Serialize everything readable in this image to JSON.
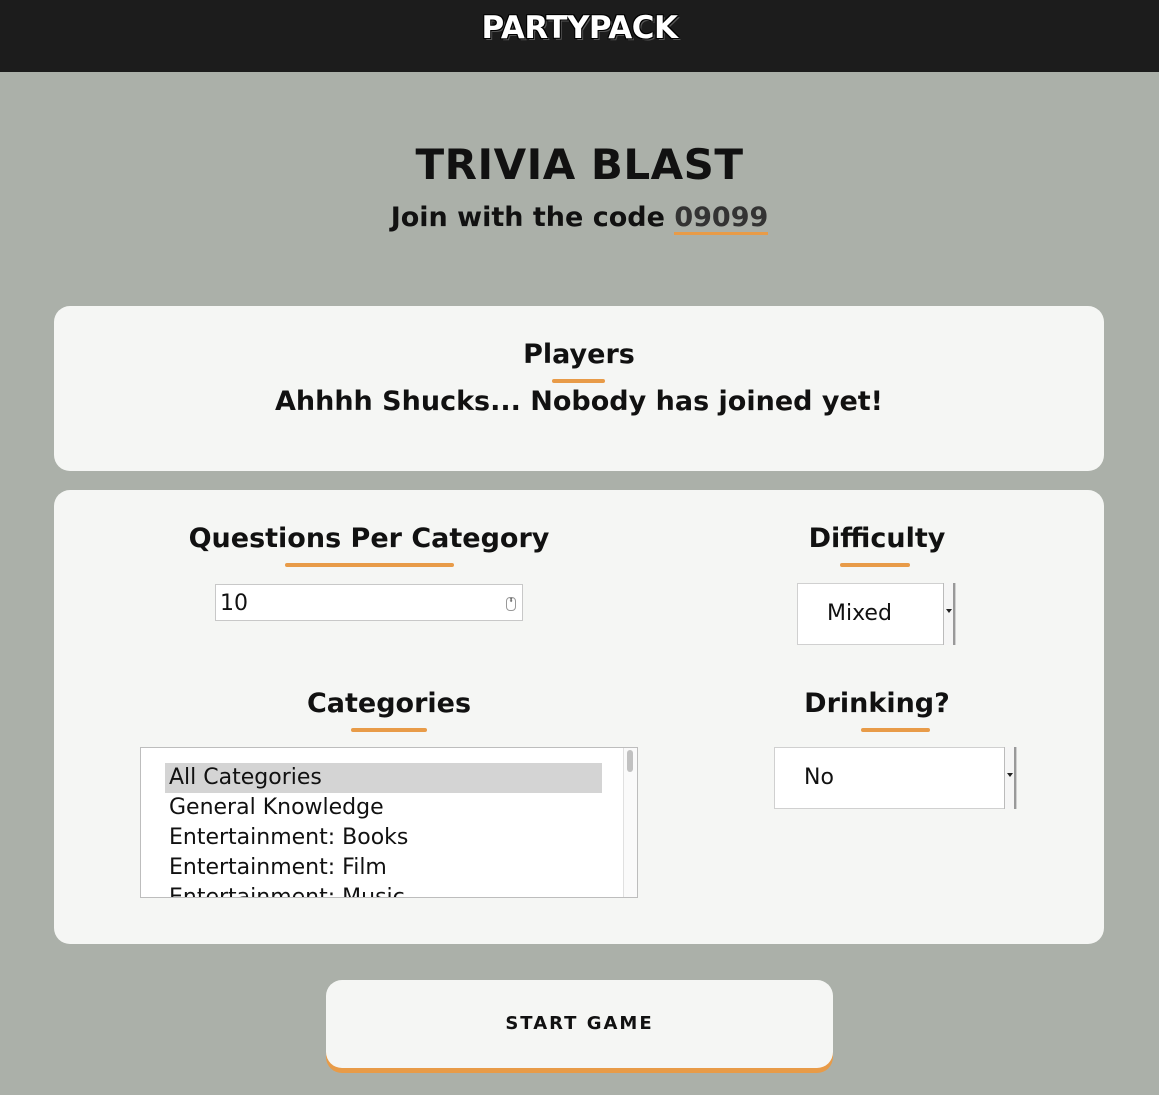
{
  "header": {
    "logo": "PARTYPACK"
  },
  "game": {
    "title": "TRIVIA BLAST",
    "join_prefix": "Join with the code ",
    "join_code": "09099"
  },
  "players": {
    "heading": "Players",
    "empty_message": "Ahhhh Shucks... Nobody has joined yet!"
  },
  "settings": {
    "questions_heading": "Questions Per Category",
    "questions_value": "10",
    "difficulty_heading": "Difficulty",
    "difficulty_value": "Mixed",
    "categories_heading": "Categories",
    "categories_options": [
      "All Categories",
      "General Knowledge",
      "Entertainment: Books",
      "Entertainment: Film",
      "Entertainment: Music"
    ],
    "categories_selected": "All Categories",
    "drinking_heading": "Drinking?",
    "drinking_value": "No"
  },
  "actions": {
    "start_label": "START GAME"
  },
  "colors": {
    "accent": "#e89b48",
    "background": "#abb0a9",
    "card": "#f5f6f4",
    "topbar": "#1c1c1c"
  }
}
